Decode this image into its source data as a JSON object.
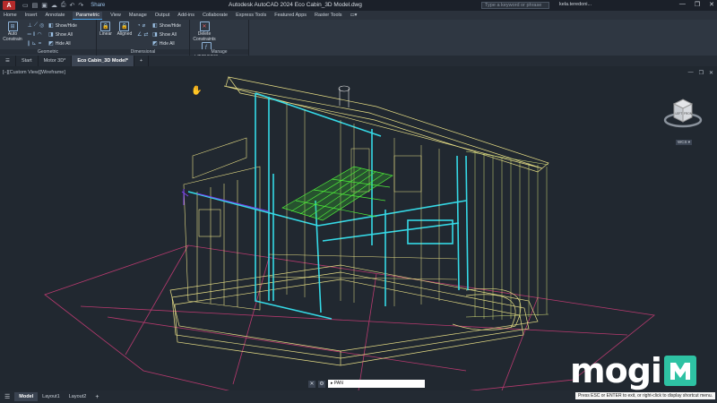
{
  "window": {
    "app_button": "A",
    "title": "Autodesk AutoCAD 2024   Eco Cabin_3D Model.dwg",
    "share": "Share",
    "search_placeholder": "Type a keyword or phrase",
    "user": "kela.teredoni...",
    "controls": [
      "—",
      "❐",
      "✕"
    ]
  },
  "ribbon_tabs": [
    "Home",
    "Insert",
    "Annotate",
    "Parametric",
    "View",
    "Manage",
    "Output",
    "Add-ins",
    "Collaborate",
    "Express Tools",
    "Featured Apps",
    "Raster Tools"
  ],
  "active_ribbon_tab": "Parametric",
  "ribbon": {
    "geometric": {
      "label": "Geometric",
      "auto_constrain": "Auto Constrain",
      "show_hide": "Show/Hide",
      "show_all": "Show All",
      "hide_all": "Hide All"
    },
    "dimensional": {
      "label": "Dimensional",
      "linear": "Linear",
      "aligned": "Aligned",
      "show_hide": "Show/Hide",
      "show_all": "Show All",
      "hide_all": "Hide All"
    },
    "manage": {
      "label": "Manage",
      "delete_constraints": "Delete Constraints",
      "parameters_manager": "Parameters Manager"
    }
  },
  "file_tabs": [
    "Start",
    "Motor 3D*",
    "Eco Cabin_3D Model*"
  ],
  "active_file_tab": "Eco Cabin_3D Model*",
  "viewport": {
    "label": "[–][Custom View][Wireframe]",
    "controls": [
      "—",
      "❐",
      "✕"
    ],
    "viewcube_faces": [
      "LEFT",
      "FRONT"
    ],
    "wcs": "WCS ▾"
  },
  "logo": {
    "text": "mogi"
  },
  "status": {
    "layout_tabs": [
      "Model",
      "Layout1",
      "Layout2"
    ],
    "active_layout": "Model",
    "command_value": "PAN",
    "tip": "Press ESC or ENTER to exit, or right-click to display shortcut menu."
  },
  "colors": {
    "wire_yellow": "#e8df86",
    "wire_cyan": "#35d9e6",
    "wire_green": "#4ff03a",
    "wire_magenta": "#b83a6f",
    "wire_purple": "#7a3ef0",
    "logo_accent": "#2ec2a3"
  }
}
